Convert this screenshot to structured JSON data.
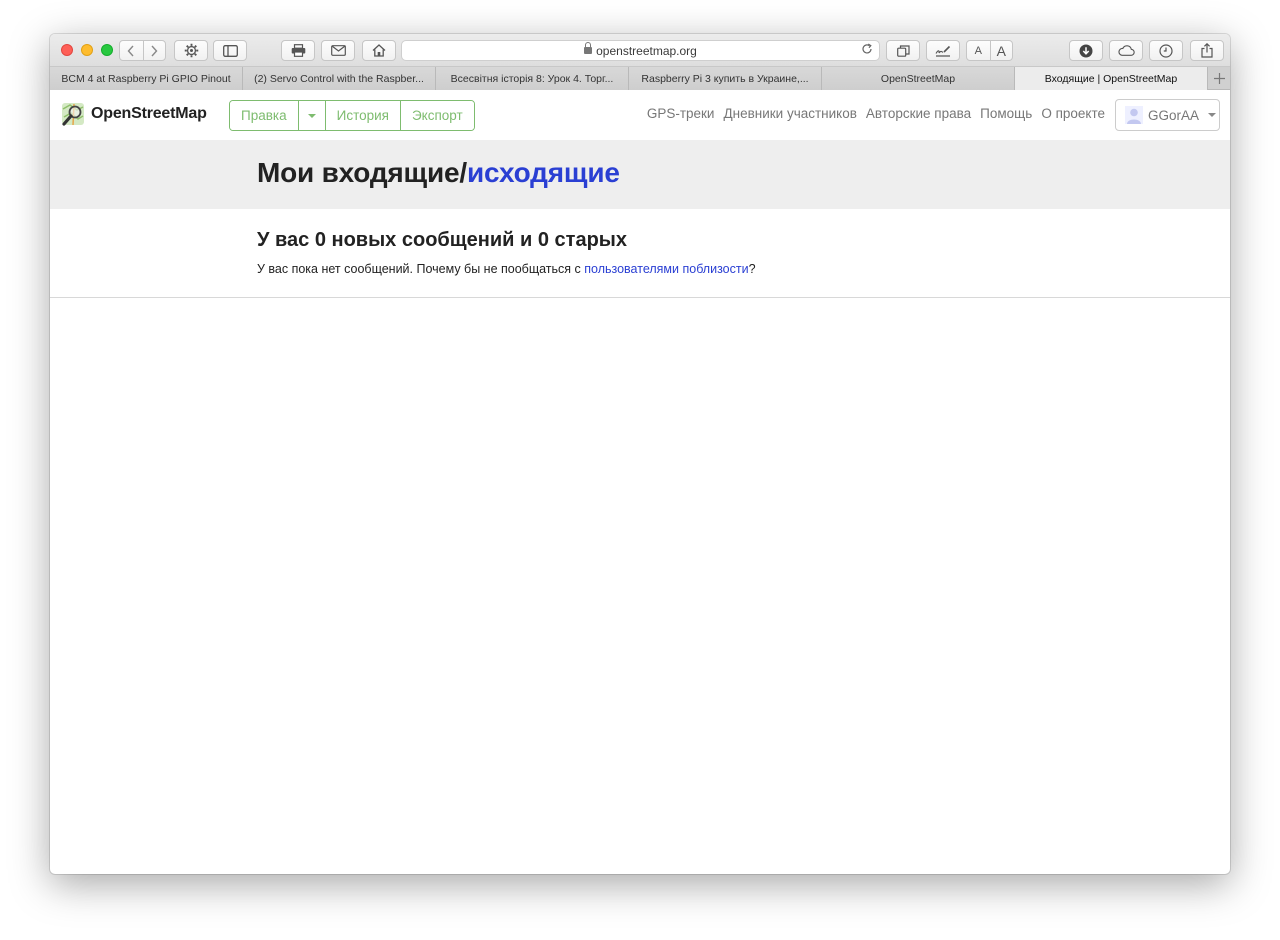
{
  "browser": {
    "url": "openstreetmap.org",
    "tabs": [
      {
        "label": "BCM 4 at Raspberry Pi GPIO Pinout"
      },
      {
        "label": "(2) Servo Control with the Raspber..."
      },
      {
        "label": "Всесвітня історія 8: Урок 4. Торг..."
      },
      {
        "label": "Raspberry Pi 3 купить в Украине,..."
      },
      {
        "label": "OpenStreetMap"
      },
      {
        "label": "Входящие | OpenStreetMap"
      }
    ],
    "font_small": "A",
    "font_large": "A"
  },
  "osm": {
    "logo_text": "OpenStreetMap",
    "edit_label": "Правка",
    "history_label": "История",
    "export_label": "Экспорт",
    "nav": [
      "GPS-треки",
      "Дневники участников",
      "Авторские права",
      "Помощь",
      "О проекте"
    ],
    "username": "GGorAA"
  },
  "page": {
    "title_prefix": "Мои входящие/",
    "title_link": "исходящие",
    "summary": "У вас 0 новых сообщений и 0 старых",
    "empty_text": "У вас пока нет сообщений. Почему бы не пообщаться с ",
    "empty_link": "пользователями поблизости",
    "empty_suffix": "?"
  },
  "colors": {
    "accent_green": "#7ebc6f",
    "link_blue": "#2a3fd3"
  }
}
